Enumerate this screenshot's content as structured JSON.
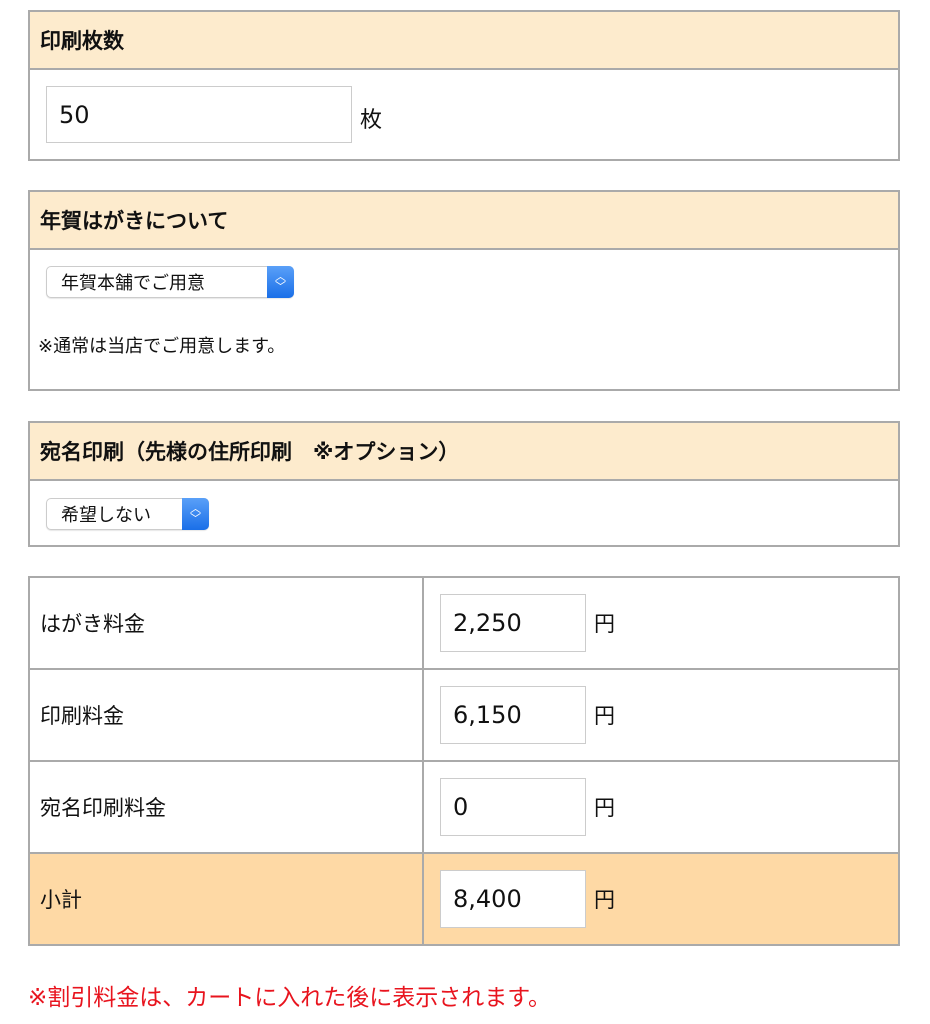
{
  "print_count": {
    "title": "印刷枚数",
    "value": "50",
    "unit": "枚"
  },
  "nenga": {
    "title": "年賀はがきについて",
    "selected": "年賀本舗でご用意",
    "note": "※通常は当店でご用意します。"
  },
  "address": {
    "title": "宛名印刷（先様の住所印刷　※オプション）",
    "selected": "希望しない"
  },
  "fees": [
    {
      "label": "はがき料金",
      "value": "2,250",
      "unit": "円"
    },
    {
      "label": "印刷料金",
      "value": "6,150",
      "unit": "円"
    },
    {
      "label": "宛名印刷料金",
      "value": "0",
      "unit": "円"
    },
    {
      "label": "小計",
      "value": "8,400",
      "unit": "円"
    }
  ],
  "discount_note": "※割引料金は、カートに入れた後に表示されます。",
  "colors": {
    "header_bg": "#fdebcd",
    "subtotal_bg": "#fed9a5",
    "note": "#e8141e",
    "select_accent": "#1a6fe8"
  }
}
